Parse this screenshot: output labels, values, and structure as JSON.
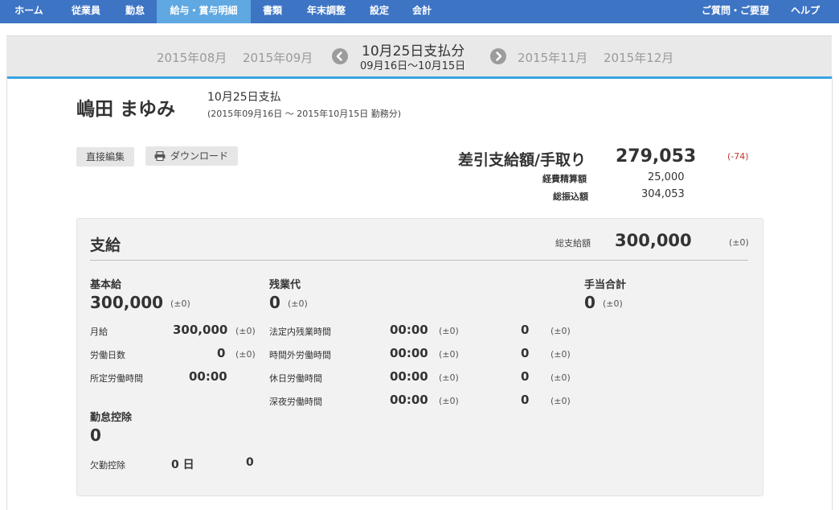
{
  "nav": {
    "items": [
      "ホーム",
      "従業員",
      "勤怠",
      "給与・賞与明細",
      "書類",
      "年末調整",
      "設定",
      "会計"
    ],
    "right_items": [
      "ご質問・ご要望",
      "ヘルプ"
    ]
  },
  "month_bar": {
    "prev_months": [
      "2015年08月",
      "2015年09月"
    ],
    "current_title": "10月25日支払分",
    "current_range": "09月16日〜10月15日",
    "next_months": [
      "2015年11月",
      "2015年12月"
    ]
  },
  "employee": {
    "name": "嶋田 まゆみ",
    "payday": "10月25日支払",
    "period": "(2015年09月16日 〜 2015年10月15日 勤務分)"
  },
  "buttons": {
    "edit": "直接編集",
    "download": "ダウンロード"
  },
  "summary": {
    "net_label": "差引支給額/手取り",
    "net_value": "279,053",
    "net_diff": "(-74)",
    "expense_label": "経費精算額",
    "expense_value": "25,000",
    "transfer_label": "総振込額",
    "transfer_value": "304,053"
  },
  "payment": {
    "title": "支給",
    "total_label": "総支給額",
    "total_value": "300,000",
    "total_diff": "(±0)",
    "basic": {
      "title": "基本給",
      "value": "300,000",
      "diff": "(±0)",
      "rows": [
        {
          "label": "月給",
          "value": "300,000",
          "diff": "(±0)"
        },
        {
          "label": "労働日数",
          "value": "0",
          "diff": "(±0)"
        },
        {
          "label": "所定労働時間",
          "value": "00:00"
        }
      ]
    },
    "overtime": {
      "title": "残業代",
      "value": "0",
      "diff": "(±0)",
      "rows": [
        {
          "label": "法定内残業時間",
          "time": "00:00",
          "time_diff": "(±0)",
          "amount": "0",
          "amount_diff": "(±0)"
        },
        {
          "label": "時間外労働時間",
          "time": "00:00",
          "time_diff": "(±0)",
          "amount": "0",
          "amount_diff": "(±0)"
        },
        {
          "label": "休日労働時間",
          "time": "00:00",
          "time_diff": "(±0)",
          "amount": "0",
          "amount_diff": "(±0)"
        },
        {
          "label": "深夜労働時間",
          "time": "00:00",
          "time_diff": "(±0)",
          "amount": "0",
          "amount_diff": "(±0)"
        }
      ]
    },
    "allowance": {
      "title": "手当合計",
      "value": "0",
      "diff": "(±0)"
    },
    "absence": {
      "title": "勤怠控除",
      "value": "0",
      "row": {
        "label": "欠勤控除",
        "days": "0 日",
        "amount": "0"
      }
    }
  },
  "colors": {
    "nav_bg": "#3e74c4",
    "nav_active": "#5fa8e2",
    "accent_line": "#3aa3e3",
    "negative": "#c0392b"
  },
  "icons": {
    "prev": "chevron-left-icon",
    "next": "chevron-right-icon",
    "print": "printer-icon"
  }
}
